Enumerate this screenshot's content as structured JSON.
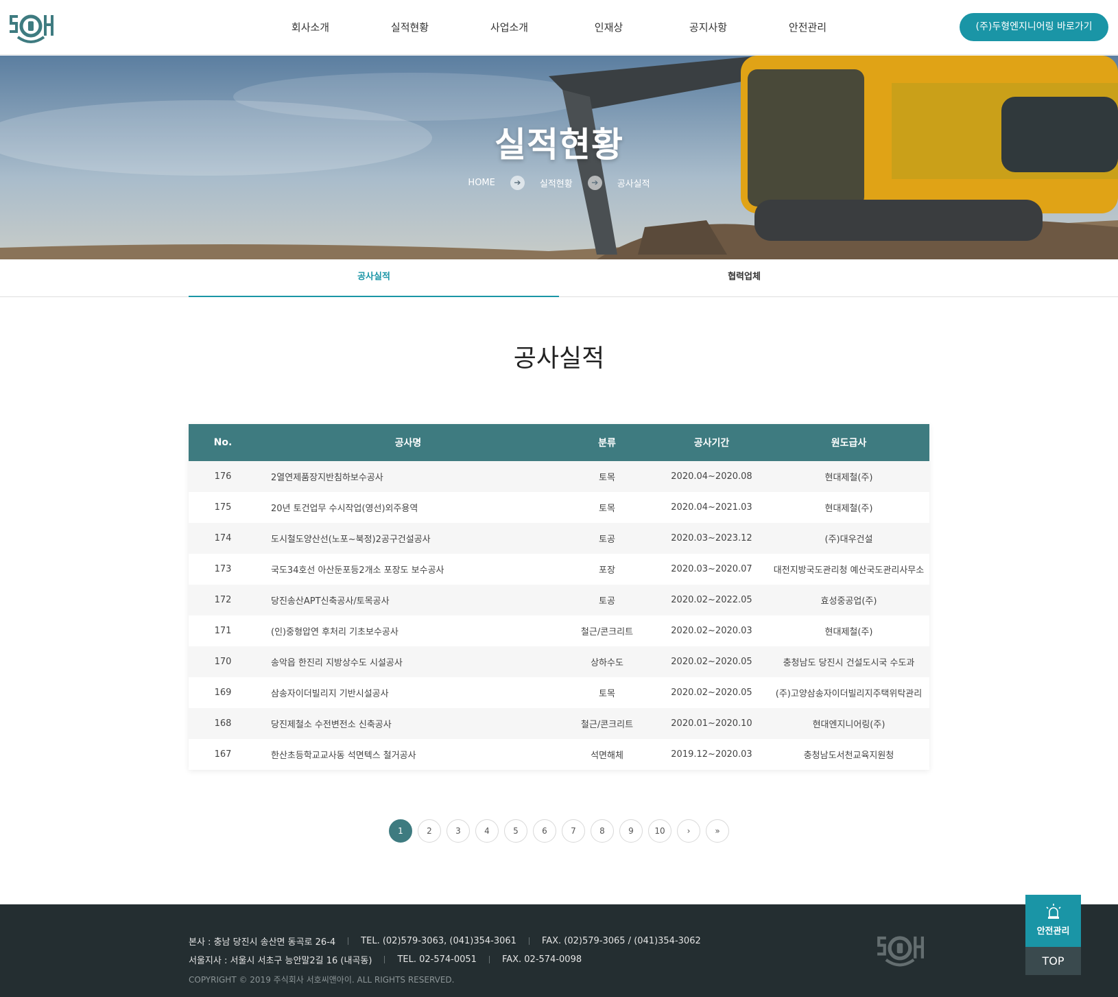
{
  "brand": {
    "logo_name": "SEOHO"
  },
  "nav": {
    "items": [
      "회사소개",
      "실적현황",
      "사업소개",
      "인재상",
      "공지사항",
      "안전관리"
    ],
    "partner_button": "(주)두형엔지니어링 바로가기"
  },
  "hero": {
    "title": "실적현황",
    "breadcrumb": [
      "HOME",
      "실적현황",
      "공사실적"
    ]
  },
  "subtabs": {
    "items": [
      "공사실적",
      "협력업체"
    ],
    "active": "공사실적"
  },
  "section": {
    "title": "공사실적"
  },
  "table": {
    "headers": [
      "No.",
      "공사명",
      "분류",
      "공사기간",
      "원도급사"
    ],
    "rows": [
      [
        "176",
        "2열연제품장지반침하보수공사",
        "토목",
        "2020.04~2020.08",
        "현대제철(주)"
      ],
      [
        "175",
        "20년 토건업무 수시작업(영선)외주용역",
        "토목",
        "2020.04~2021.03",
        "현대제철(주)"
      ],
      [
        "174",
        "도시철도양산선(노포~북정)2공구건설공사",
        "토공",
        "2020.03~2023.12",
        "(주)대우건설"
      ],
      [
        "173",
        "국도34호선 아산둔포등2개소 포장도 보수공사",
        "포장",
        "2020.03~2020.07",
        "대전지방국도관리청 예산국도관리사무소"
      ],
      [
        "172",
        "당진송산APT신축공사/토목공사",
        "토공",
        "2020.02~2022.05",
        "효성중공업(주)"
      ],
      [
        "171",
        "(인)중형압연 후처리 기초보수공사",
        "철근/콘크리트",
        "2020.02~2020.03",
        "현대제철(주)"
      ],
      [
        "170",
        "송악읍 한진리 지방상수도 시설공사",
        "상하수도",
        "2020.02~2020.05",
        "충청남도 당진시 건설도시국 수도과"
      ],
      [
        "169",
        "삼송자이더빌리지 기반시설공사",
        "토목",
        "2020.02~2020.05",
        "(주)고양삼송자이더빌리지주택위탁관리"
      ],
      [
        "168",
        "당진제철소 수전변전소 신축공사",
        "철근/콘크리트",
        "2020.01~2020.10",
        "현대엔지니어링(주)"
      ],
      [
        "167",
        "한산초등학교교사동 석면텍스 철거공사",
        "석면해체",
        "2019.12~2020.03",
        "충청남도서천교육지원청"
      ]
    ]
  },
  "pagination": {
    "pages": [
      "1",
      "2",
      "3",
      "4",
      "5",
      "6",
      "7",
      "8",
      "9",
      "10"
    ],
    "current": "1",
    "next": "›",
    "last": "»"
  },
  "footer": {
    "line1": [
      "본사 : 충남 당진시 송산면 동곡로 26-4",
      "TEL. (02)579-3063, (041)354-3061",
      "FAX. (02)579-3065 / (041)354-3062"
    ],
    "line2": [
      "서울지사 : 서울시 서초구 능안말2길 16 (내곡동)",
      "TEL. 02-574-0051",
      "FAX. 02-574-0098"
    ],
    "copyright": "COPYRIGHT © 2019 주식회사 서호씨앤아이. ALL RIGHTS RESERVED."
  },
  "floating": {
    "safety_label": "안전관리",
    "top_label": "TOP"
  },
  "colors": {
    "accent": "#1a95a6",
    "table_header": "#3e7b80",
    "footer_bg": "#242e31"
  }
}
